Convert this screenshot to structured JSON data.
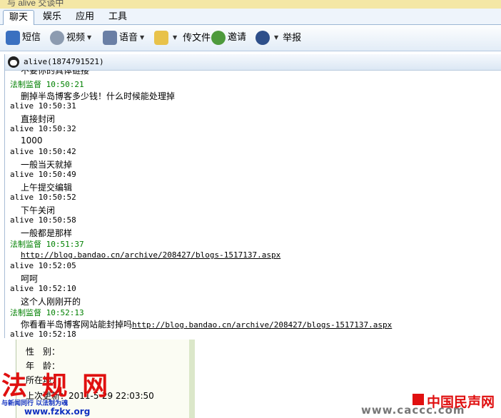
{
  "window": {
    "title_fragment": "与 alive 交谈中"
  },
  "tabs": [
    {
      "label": "聊天"
    },
    {
      "label": "娱乐"
    },
    {
      "label": "应用"
    },
    {
      "label": "工具"
    }
  ],
  "toolbar": {
    "sms": "短信",
    "video": "视频",
    "voice": "语音",
    "send_file": "传文件",
    "invite": "邀请",
    "report": "举报"
  },
  "chat": {
    "contact": "alive(1874791521)",
    "cut_line": "不要你的具体链接",
    "messages": [
      {
        "sender": "法制监督 10:50:21",
        "text": "删掉半岛博客多少钱！什么时候能处理掉"
      },
      {
        "sender": "alive 10:50:31",
        "text": "直接封闭"
      },
      {
        "sender": "alive 10:50:32",
        "text": "1000"
      },
      {
        "sender": "alive 10:50:42",
        "text": "一般当天就掉"
      },
      {
        "sender": "alive 10:50:49",
        "text": "上午提交编辑"
      },
      {
        "sender": "alive 10:50:52",
        "text": "下午关闭"
      },
      {
        "sender": "alive 10:50:58",
        "text": "一般都是那样"
      },
      {
        "sender": "法制监督 10:51:37",
        "text": "http://blog.bandao.cn/archive/208427/blogs-1517137.aspx"
      },
      {
        "sender": "alive 10:52:05",
        "text": "呵呵"
      },
      {
        "sender": "alive 10:52:10",
        "text": "这个人刚刚开的"
      },
      {
        "sender": "法制监督 10:52:13",
        "text": "你看看半岛博客网站能封掉吗",
        "link": "http://blog.bandao.cn/archive/208427/blogs-1517137.aspx"
      },
      {
        "sender": "alive 10:52:18",
        "text": ""
      }
    ]
  },
  "profile": {
    "gender": "性　别：",
    "age": "年　龄：",
    "location": "所在地：",
    "last_update": "上次更新：2011-5-29 22:03:50"
  },
  "watermarks": {
    "left_logo": "法 规 网",
    "left_slogan": "与新闻同行 以法制为魂",
    "left_url": "www.fzkx.org",
    "right_logo": "中国民声网",
    "right_url": "www.caccc.com"
  },
  "colors": {
    "self_sender": "#008000",
    "watermark_red": "#e01010",
    "watermark_blue": "#1030c0"
  }
}
